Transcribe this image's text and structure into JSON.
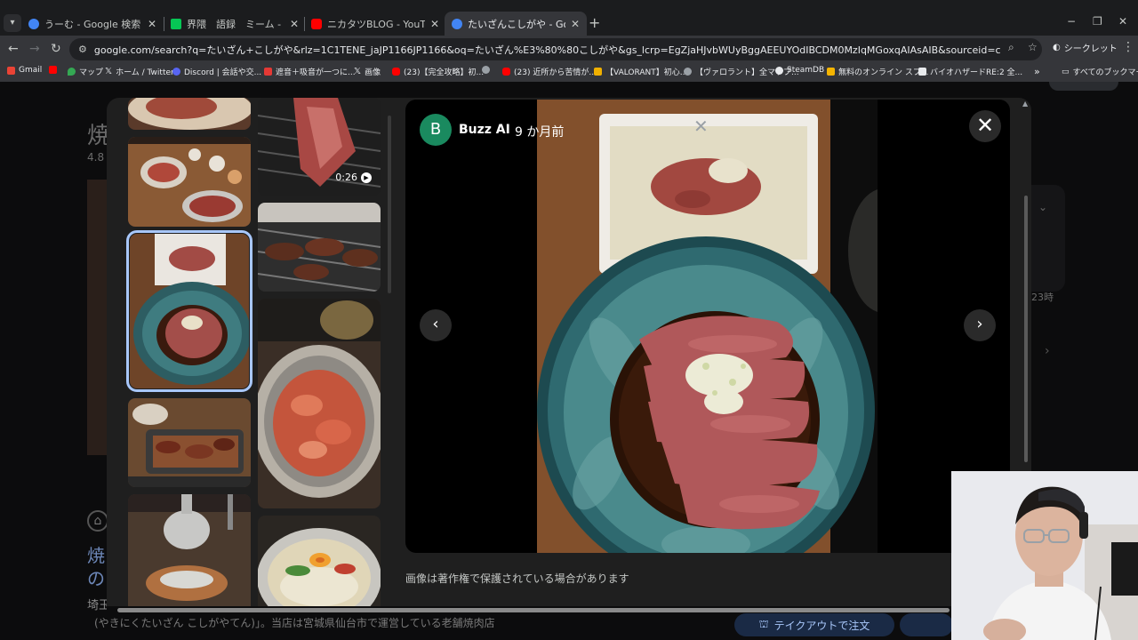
{
  "tabs": [
    {
      "title": "うーむ - Google 検索",
      "favicon_color": "#4285f4",
      "active": false
    },
    {
      "title": "界隈　語録　ミーム - LINE スタンプ",
      "favicon_color": "#06c755",
      "active": false
    },
    {
      "title": "ニカタツBLOG - YouTube",
      "favicon_color": "#ff0000",
      "active": false
    },
    {
      "title": "たいざんこしがや - Google 検索",
      "favicon_color": "#4285f4",
      "active": true
    }
  ],
  "window_controls": {
    "minimize": "−",
    "restore": "❐",
    "close": "✕"
  },
  "address_bar": {
    "url": "google.com/search?q=たいざん+こしがや&rlz=1C1TENE_jaJP1166JP1166&oq=たいざん%E3%80%80こしがや&gs_lcrp=EgZjaHJvbWUyBggAEEUYOdIBCDM0MzIqMGoxqAIAsAIB&sourceid=chrome&ie=UTF-8#lpg=cid:CgIYIA%3D%3D,ik:CAoSFkNJSE0wb...",
    "incognito_label": "シークレット"
  },
  "bookmarks": [
    {
      "label": "Gmail",
      "color": "#ea4335"
    },
    {
      "label": "",
      "color": "#ff0000"
    },
    {
      "label": "マップ",
      "color": "#34a853"
    },
    {
      "label": "ホーム / Twitter",
      "color": "#e8eaed"
    },
    {
      "label": "Discord | 会話や交...",
      "color": "#5865f2"
    },
    {
      "label": "遮音＋吸音が一つに...",
      "color": "#e53935"
    },
    {
      "label": "画像",
      "color": "#e8eaed"
    },
    {
      "label": "(23)【完全攻略】初...",
      "color": "#ff0000"
    },
    {
      "label": "",
      "color": "#9aa0a6"
    },
    {
      "label": "(23) 近所から苦情が...",
      "color": "#ff0000"
    },
    {
      "label": "【VALORANT】初心...",
      "color": "#f0b000"
    },
    {
      "label": "【ヴァロラント】全マップ...",
      "color": "#9aa0a6"
    },
    {
      "label": "SteamDB",
      "color": "#e8eaed"
    },
    {
      "label": "無料のオンライン スプ...",
      "color": "#f4b400"
    },
    {
      "label": "バイオハザードRE:2 全...",
      "color": "#e8eaed"
    }
  ],
  "bookmarks_more": "»",
  "bookmarks_all": "すべてのブックマーク",
  "viewer": {
    "source_initial": "B",
    "source_name": "Buzz AI",
    "source_dot": "·",
    "source_age": "9 か月前",
    "video_duration": "0:26",
    "copyright_notice": "画像は著作権で保護されている場合があります",
    "colors": {
      "selected_outline": "#a8c7fa",
      "avatar": "#1a8a5f"
    }
  },
  "background_page": {
    "title_fragment": "焼",
    "rating_fragment": "4.8",
    "link_fragment_1": "焼",
    "link_fragment_2": "の",
    "address_fragment": "埼玉",
    "description": "(やきにくたいざん こしがやてん)」。当店は宮城県仙台市で運営している老舗焼肉店",
    "hours_fragment": "23時",
    "takeout_button": "テイクアウトで注文"
  }
}
